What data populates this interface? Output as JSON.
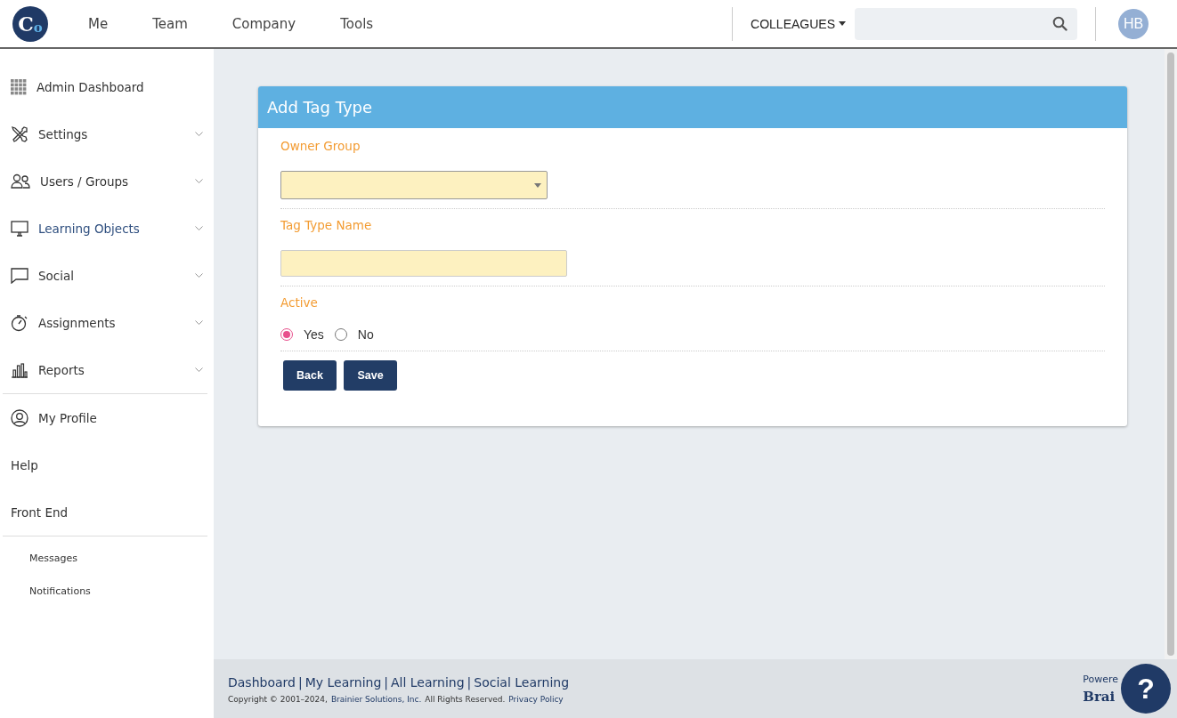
{
  "header": {
    "logo": {
      "first": "C",
      "second": "o"
    },
    "nav": [
      {
        "label": "Me"
      },
      {
        "label": "Team"
      },
      {
        "label": "Company"
      },
      {
        "label": "Tools"
      }
    ],
    "colleagues_menu": {
      "label": "COLLEAGUES"
    },
    "avatar": {
      "initials": "HB"
    }
  },
  "sidebar": {
    "sections": [
      {
        "items": [
          {
            "label": "Admin Dashboard",
            "kind": "grid",
            "expandable": false,
            "selected": false
          },
          {
            "label": "Settings",
            "kind": "tools",
            "expandable": true,
            "selected": false
          },
          {
            "label": "Users / Groups",
            "kind": "users",
            "expandable": true,
            "selected": false
          },
          {
            "label": "Learning Objects",
            "kind": "monitor",
            "expandable": true,
            "selected": true
          },
          {
            "label": "Social",
            "kind": "chat",
            "expandable": true,
            "selected": false
          },
          {
            "label": "Assignments",
            "kind": "stopwatch",
            "expandable": true,
            "selected": false
          },
          {
            "label": "Reports",
            "kind": "chart",
            "expandable": true,
            "selected": false
          }
        ]
      },
      {
        "items": [
          {
            "label": "My Profile",
            "kind": "profile",
            "expandable": false,
            "selected": false
          },
          {
            "label": "Help",
            "kind": "plain",
            "expandable": false,
            "selected": false
          },
          {
            "label": "Front End",
            "kind": "plain",
            "expandable": false,
            "selected": false
          }
        ]
      },
      {
        "items": [
          {
            "label": "Messages",
            "expandable": false,
            "selected": false
          },
          {
            "label": "Notifications",
            "expandable": false,
            "selected": false
          }
        ]
      }
    ]
  },
  "card": {
    "title": "Add Tag Type",
    "fields": [
      {
        "kind": "select",
        "label": "Owner Group"
      },
      {
        "kind": "text",
        "label": "Tag Type Name"
      },
      {
        "kind": "radio",
        "label": "Active",
        "options": [
          {
            "label": "Yes",
            "selected": true
          },
          {
            "label": "No",
            "selected": false
          }
        ]
      }
    ],
    "buttons": [
      {
        "label": "Back"
      },
      {
        "label": "Save"
      }
    ]
  },
  "footer": {
    "links": [
      {
        "label": "Dashboard"
      },
      {
        "label": "My Learning"
      },
      {
        "label": "All Learning"
      },
      {
        "label": "Social Learning"
      }
    ],
    "separator": "|",
    "copyright": "Copyright © 2001–2024,",
    "company": "Brainier Solutions, Inc.",
    "rights": "All Rights Reserved.",
    "privacy": "Privacy Policy",
    "powered": "Powere",
    "brand": "Brai"
  },
  "help_button": {
    "label": "?"
  }
}
